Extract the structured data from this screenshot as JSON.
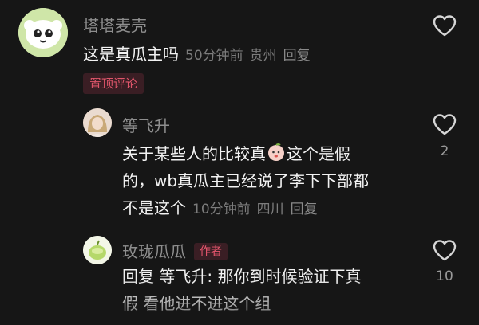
{
  "comments": [
    {
      "username": "塔塔麦壳",
      "text": "这是真瓜主吗",
      "time": "50分钟前",
      "location": "贵州",
      "reply_label": "回复",
      "badge": "置顶评论",
      "avatar_icon": "ghost-cartoon-avatar"
    },
    {
      "username": "等飞升",
      "lines": [
        "关于某些人的比较真",
        "这个是假",
        "的，wb真瓜主已经说了李下下部都",
        "不是这个"
      ],
      "emoji_icon": "peach-face-emoji",
      "time": "10分钟前",
      "location": "四川",
      "reply_label": "回复",
      "likes": "2",
      "avatar_icon": "blonde-person-avatar"
    },
    {
      "username": "玫珑瓜瓜",
      "author_badge": "作者",
      "lines": [
        "回复 等飞升: 那你到时候验证下真",
        "假 看他进不进这个组"
      ],
      "reply_prefix": "回复",
      "reply_target": "等飞升:",
      "likes": "10",
      "avatar_icon": "melon-avatar"
    }
  ],
  "colors": {
    "background": "#161616",
    "badge_text": "#e0566b",
    "badge_bg": "#3a1e24",
    "meta": "#7c7c7c",
    "name": "#8e8e8e"
  }
}
